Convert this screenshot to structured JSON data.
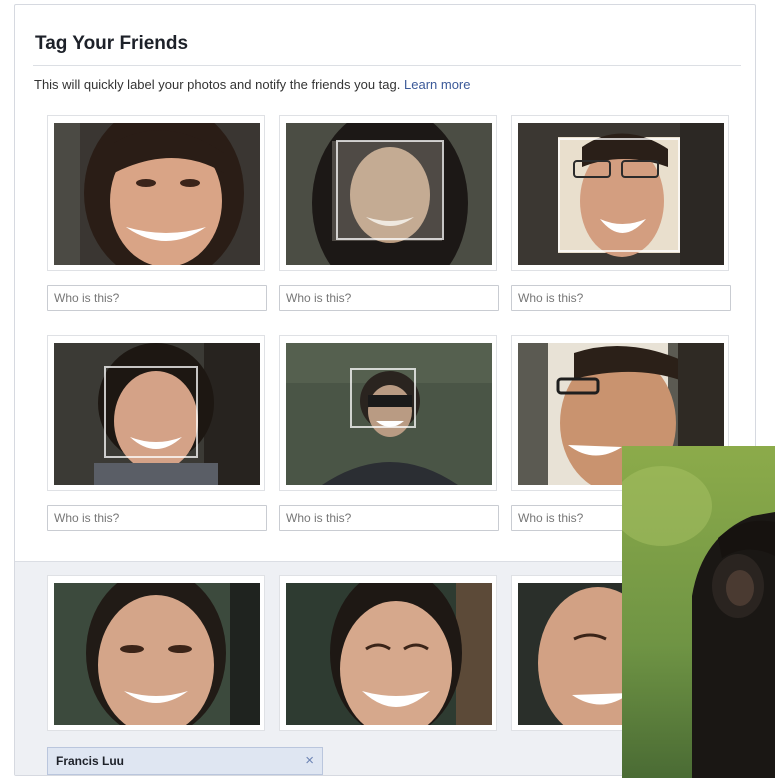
{
  "dialog": {
    "title": "Tag Your Friends",
    "intro_text": "This will quickly label your photos and notify the friends you tag.",
    "learn_more": "Learn more"
  },
  "photos": [
    {
      "placeholder": "Who is this?"
    },
    {
      "placeholder": "Who is this?"
    },
    {
      "placeholder": "Who is this?"
    },
    {
      "placeholder": "Who is this?"
    },
    {
      "placeholder": "Who is this?"
    },
    {
      "placeholder": "Who is this?"
    }
  ],
  "tagged": {
    "name": "Francis Luu",
    "remove_glyph": "×"
  },
  "colors": {
    "link": "#3b5998",
    "tag_bg": "#dfe6f2",
    "tagged_zone_bg": "#eef0f4"
  }
}
